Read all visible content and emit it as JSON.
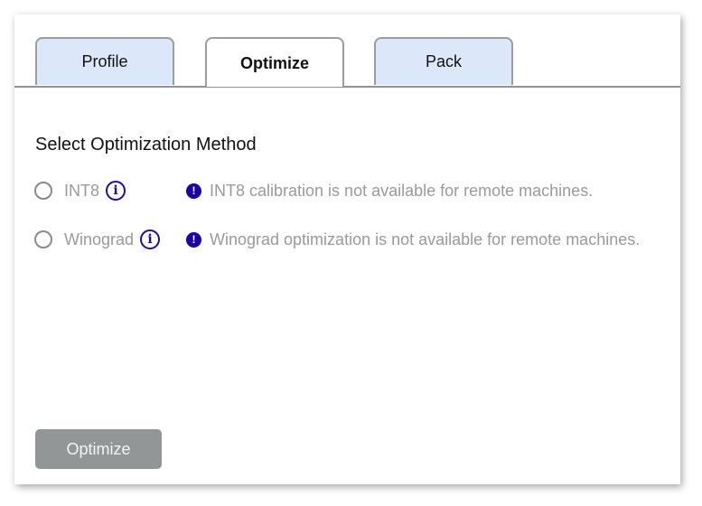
{
  "tabs": [
    {
      "label": "Profile",
      "active": false
    },
    {
      "label": "Optimize",
      "active": true
    },
    {
      "label": "Pack",
      "active": false
    }
  ],
  "section": {
    "title": "Select Optimization Method"
  },
  "options": [
    {
      "label": "INT8",
      "selected": false,
      "info_icon": "info-circle-icon",
      "warning_icon": "exclamation-circle-icon",
      "warning": "INT8 calibration is not available for remote machines."
    },
    {
      "label": "Winograd",
      "selected": false,
      "info_icon": "info-circle-icon",
      "warning_icon": "exclamation-circle-icon",
      "warning": "Winograd optimization is not available for remote machines."
    }
  ],
  "actions": {
    "optimize_label": "Optimize",
    "optimize_disabled": true
  },
  "colors": {
    "tab_inactive_bg": "#dce8fa",
    "accent_icon": "#1a0fa0",
    "disabled_text": "#9a9a9a",
    "button_disabled_bg": "#939696"
  }
}
